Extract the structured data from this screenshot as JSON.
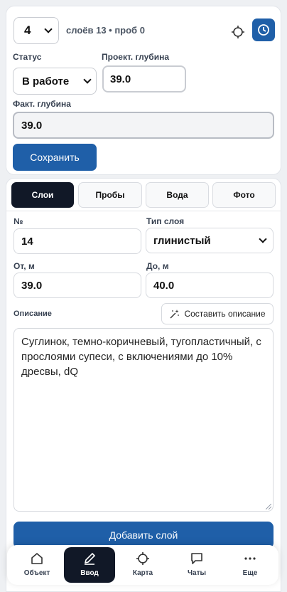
{
  "header": {
    "layer_select": "4",
    "layers_meta": "слоёв 13 • проб 0"
  },
  "status": {
    "label": "Статус",
    "value": "В работе"
  },
  "project_depth": {
    "label": "Проект. глубина",
    "value": "39.0"
  },
  "fact_depth": {
    "label": "Факт. глубина",
    "value": "39.0"
  },
  "save_label": "Сохранить",
  "tabs": [
    {
      "label": "Слои",
      "active": true
    },
    {
      "label": "Пробы",
      "active": false
    },
    {
      "label": "Вода",
      "active": false
    },
    {
      "label": "Фото",
      "active": false
    }
  ],
  "layer_form": {
    "number_label": "№",
    "number_value": "14",
    "type_label": "Тип слоя",
    "type_value": "глинистый",
    "from_label": "От, м",
    "from_value": "39.0",
    "to_label": "До, м",
    "to_value": "40.0",
    "desc_label": "Описание",
    "compose_label": "Составить описание",
    "description": "Суглинок, темно-коричневый, тугопластичный, с прослоями супеси, с включениями до 10% дресвы, dQ",
    "add_label": "Добавить слой"
  },
  "nav": [
    {
      "label": "Объект",
      "icon": "home-icon"
    },
    {
      "label": "Ввод",
      "icon": "pen-icon",
      "active": true
    },
    {
      "label": "Карта",
      "icon": "crosshair-icon"
    },
    {
      "label": "Чаты",
      "icon": "chat-icon"
    },
    {
      "label": "Еще",
      "icon": "more-icon"
    }
  ],
  "colors": {
    "primary": "#1f5fa8",
    "dark": "#111827"
  }
}
